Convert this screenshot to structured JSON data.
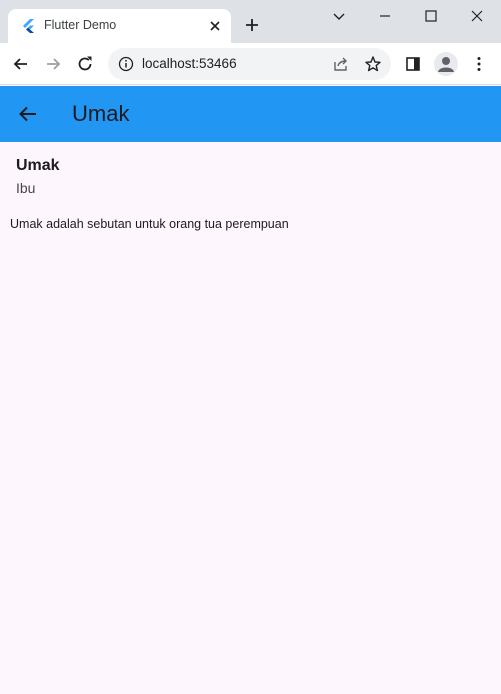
{
  "browser": {
    "tab_title": "Flutter Demo",
    "url": "localhost:53466"
  },
  "appbar": {
    "title": "Umak"
  },
  "content": {
    "word": "Umak",
    "meaning": "Ibu",
    "description": "Umak adalah sebutan untuk orang tua perempuan"
  },
  "colors": {
    "appbar": "#2196f3",
    "background": "#fdf7fd"
  }
}
